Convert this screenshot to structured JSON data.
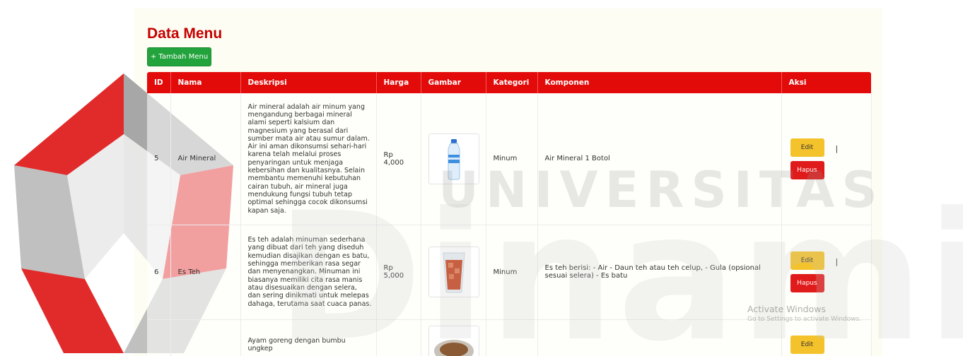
{
  "page": {
    "title": "Data Menu",
    "add_button": "+ Tambah Menu"
  },
  "table": {
    "headers": [
      "ID",
      "Nama",
      "Deskripsi",
      "Harga",
      "Gambar",
      "Kategori",
      "Komponen",
      "Aksi"
    ],
    "rows": [
      {
        "id": "5",
        "nama": "Air Mineral",
        "deskripsi": "Air mineral adalah air minum yang mengandung berbagai mineral alami seperti kalsium dan magnesium yang berasal dari sumber mata air atau sumur dalam. Air ini aman dikonsumsi sehari-hari karena telah melalui proses penyaringan untuk menjaga kebersihan dan kualitasnya. Selain membantu memenuhi kebutuhan cairan tubuh, air mineral juga mendukung fungsi tubuh tetap optimal sehingga cocok dikonsumsi kapan saja.",
        "harga": "Rp 4,000",
        "gambar": "bottle-image",
        "kategori": "Minum",
        "komponen": "Air Mineral 1 Botol",
        "edit": "Edit",
        "hapus": "Hapus"
      },
      {
        "id": "6",
        "nama": "Es Teh",
        "deskripsi": "Es teh adalah minuman sederhana yang dibuat dari teh yang diseduh kemudian disajikan dengan es batu, sehingga memberikan rasa segar dan menyenangkan. Minuman ini biasanya memiliki cita rasa manis atau disesuaikan dengan selera, dan sering dinikmati untuk melepas dahaga, terutama saat cuaca panas.",
        "harga": "Rp 5,000",
        "gambar": "iced-tea-image",
        "kategori": "Minum",
        "komponen": "Es teh berisi: - Air - Daun teh atau teh celup, - Gula (opsional sesuai selera) - Es batu",
        "edit": "Edit",
        "hapus": "Hapus"
      },
      {
        "deskripsi": "Ayam goreng dengan bumbu ungkep",
        "gambar": "fried-chicken-image",
        "edit": "Edit"
      }
    ],
    "pipe": "|"
  },
  "watermark": {
    "text": "UNIVERSITAS",
    "big": "Dinamika"
  },
  "os_notice": {
    "line1": "Activate Windows",
    "line2": "Go to Settings to activate Windows."
  },
  "colors": {
    "header_red": "#e30a0a",
    "title_red": "#c60000",
    "add_green": "#22a33c",
    "edit_yellow": "#f4c22a",
    "hapus_red": "#e01b1b",
    "logo_red": "#e02020"
  }
}
